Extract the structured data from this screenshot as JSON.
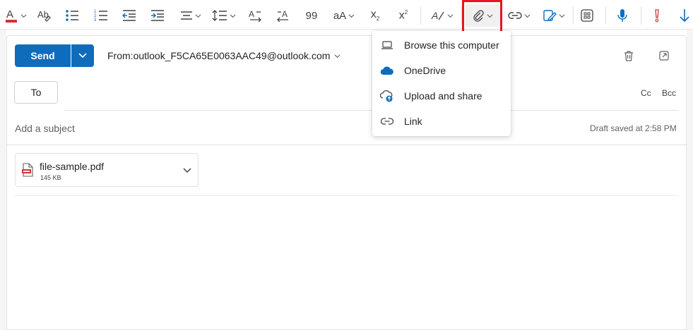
{
  "toolbar": {
    "items": [
      {
        "name": "font-color-icon"
      },
      {
        "name": "format-painter-icon"
      },
      {
        "name": "bullets-icon"
      },
      {
        "name": "numbering-icon"
      },
      {
        "name": "decrease-indent-icon"
      },
      {
        "name": "increase-indent-icon"
      },
      {
        "name": "align-icon"
      },
      {
        "name": "line-spacing-icon"
      },
      {
        "name": "ltr-icon"
      },
      {
        "name": "rtl-icon"
      },
      {
        "name": "quote-icon",
        "label": "99"
      },
      {
        "name": "change-case-icon",
        "label": "aA"
      },
      {
        "name": "subscript-icon",
        "label": "x",
        "sub": "2"
      },
      {
        "name": "superscript-icon",
        "label": "x",
        "sup": "2"
      },
      {
        "name": "styles-icon"
      },
      {
        "name": "attach-file-icon"
      },
      {
        "name": "link-icon"
      },
      {
        "name": "signature-icon"
      },
      {
        "name": "apps-icon"
      },
      {
        "name": "dictate-icon"
      },
      {
        "name": "importance-high-icon"
      },
      {
        "name": "importance-low-icon"
      }
    ],
    "accent_colors": {
      "font_color_bar": "#d13438",
      "dictate": "#0f6cbd",
      "importance_high": "#d13438",
      "importance_low": "#0f6cbd"
    }
  },
  "compose": {
    "send_label": "Send",
    "from_label": "From:",
    "from_address": "outlook_F5CA65E0063AAC49@outlook.com",
    "to_label": "To",
    "cc_label": "Cc",
    "bcc_label": "Bcc",
    "subject_placeholder": "Add a subject",
    "draft_status": "Draft saved at 2:58 PM",
    "attachment": {
      "name": "file-sample.pdf",
      "size": "145 KB"
    }
  },
  "attach_menu": {
    "items": [
      {
        "label": "Browse this computer",
        "icon": "laptop-icon"
      },
      {
        "label": "OneDrive",
        "icon": "onedrive-icon"
      },
      {
        "label": "Upload and share",
        "icon": "cloud-upload-icon"
      },
      {
        "label": "Link",
        "icon": "link-icon"
      }
    ]
  },
  "colors": {
    "accent": "#0f6cbd",
    "onedrive": "#0f6cbd",
    "highlight": "#e8151f"
  }
}
